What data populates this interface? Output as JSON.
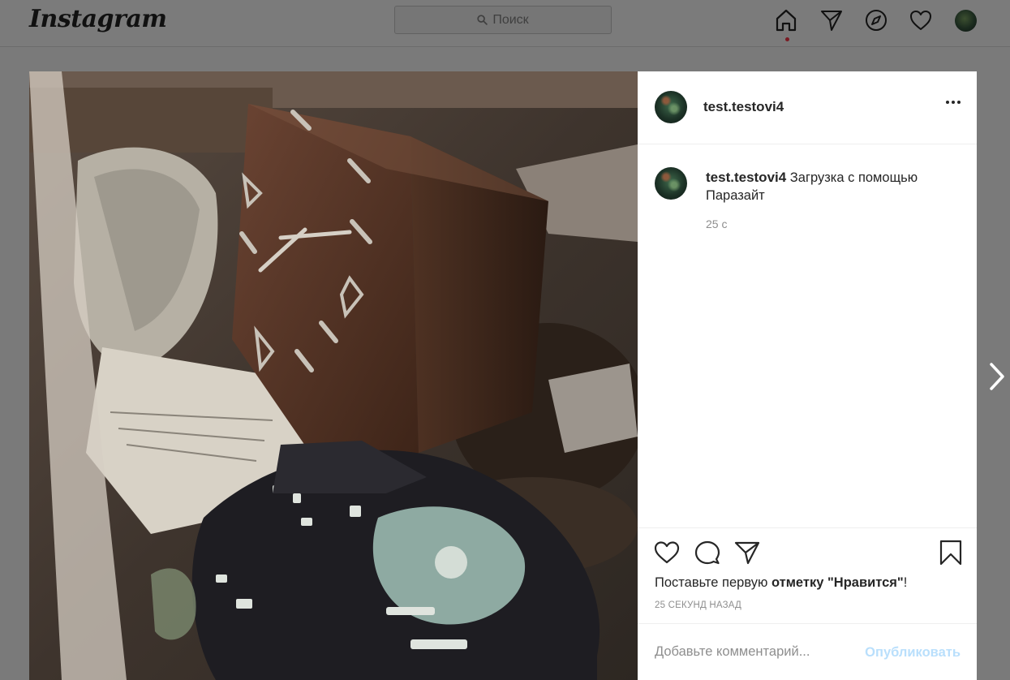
{
  "app": {
    "logo": "Instagram"
  },
  "search": {
    "placeholder": "Поиск"
  },
  "nav": {
    "icons": [
      "home-icon",
      "direct-icon",
      "explore-icon",
      "activity-heart-icon",
      "profile-avatar"
    ],
    "active": "home"
  },
  "post": {
    "author": "test.testovi4",
    "caption_user": "test.testovi4",
    "caption_text": "Загрузка с помощью Паразайт",
    "caption_time": "25 с",
    "likes_prefix": "Поставьте первую ",
    "likes_bold": "отметку \"Нравится\"",
    "likes_suffix": "!",
    "posted_ago": "25 СЕКУНД НАЗАД"
  },
  "comment": {
    "placeholder": "Добавьте комментарий...",
    "publish_label": "Опубликовать"
  },
  "colors": {
    "overlay_bg": "#7a7a7a",
    "publish_disabled": "#b9dffc",
    "text_primary": "#262626",
    "text_secondary": "#8e8e8e"
  }
}
